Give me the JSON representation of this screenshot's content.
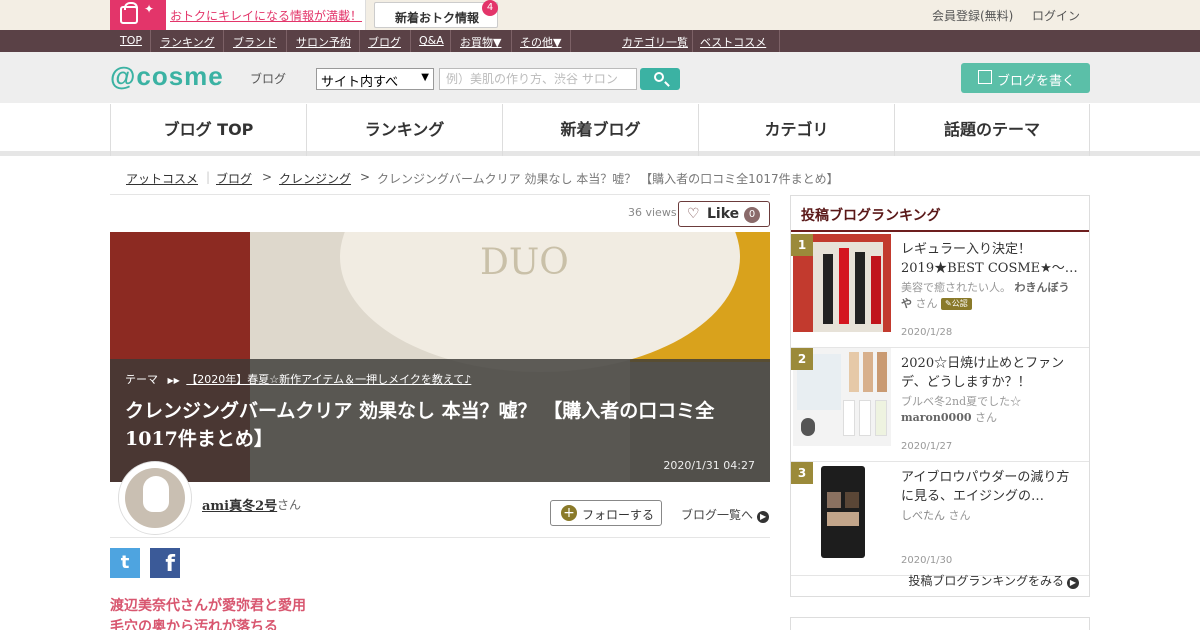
{
  "topbar": {
    "promo_text": "おトクにキレイになる情報が満載！",
    "news_label": "新着おトク情報",
    "news_count": "4",
    "register": "会員登録(無料)",
    "login": "ログイン"
  },
  "navbar": {
    "items": [
      "TOP",
      "ランキング",
      "ブランド",
      "サロン予約",
      "ブログ",
      "Q&A",
      "お買物▼",
      "その他▼",
      "カテゴリ一覧",
      "ベストコスメ"
    ]
  },
  "header": {
    "logo": "@cosme",
    "logo_sub": "ブログ",
    "select_value": "サイト内すべ",
    "search_placeholder": "例）美肌の作り方、渋谷 サロン",
    "write_button": "ブログを書く"
  },
  "menu": [
    "ブログ TOP",
    "ランキング",
    "新着ブログ",
    "カテゴリ",
    "話題のテーマ"
  ],
  "breadcrumb": {
    "items": [
      "アットコスメ",
      "ブログ",
      "クレンジング",
      "クレンジングバームクリア 効果なし 本当？嘘？ 【購入者の口コミ全1017件まとめ】"
    ],
    "sep": ">"
  },
  "article": {
    "views": "36 views",
    "like_label": "Like",
    "like_count": "0",
    "theme_label": "テーマ",
    "theme_link": "【2020年】春夏☆新作アイテム＆一押しメイクを教えて♪",
    "title": "クレンジングバームクリア 効果なし 本当？嘘？ 【購入者の口コミ全1017件まとめ】",
    "date": "2020/1/31 04:27",
    "author": "ami真冬2号",
    "author_suffix": "さん",
    "follow": "フォローする",
    "blog_list": "ブログ一覧へ",
    "body_lines": [
      "渡辺美奈代さんが愛弥君と愛用",
      "毛穴の奥から汚れが落ちる"
    ]
  },
  "sidebar": {
    "title": "投稿ブログランキング",
    "items": [
      {
        "rank": "1",
        "title": "レギュラー入り決定！2019★BEST COSME★～…",
        "author_desc": "美容で癒されたい人。",
        "author": "わきんぼうや",
        "suffix": "さん",
        "badge": "公認",
        "date": "2020/1/28"
      },
      {
        "rank": "2",
        "title": "2020☆日焼け止めとファンデ、どうしますか？！",
        "author_desc": "ブルベ冬2nd夏でした☆",
        "author": "maron0000",
        "suffix": "さん",
        "date": "2020/1/27"
      },
      {
        "rank": "3",
        "title": "アイブロウパウダーの減り方に見る、エイジングの…",
        "author_desc": "",
        "author": "しべたん",
        "suffix": "さん",
        "date": "2020/1/30"
      }
    ],
    "more": "投稿ブログランキングをみる"
  },
  "colors": {
    "accent": "#3bb2a3",
    "brand_dark": "#5a4146",
    "promo_pink": "#e3356a",
    "rank_badge": "#9b8a3a"
  }
}
